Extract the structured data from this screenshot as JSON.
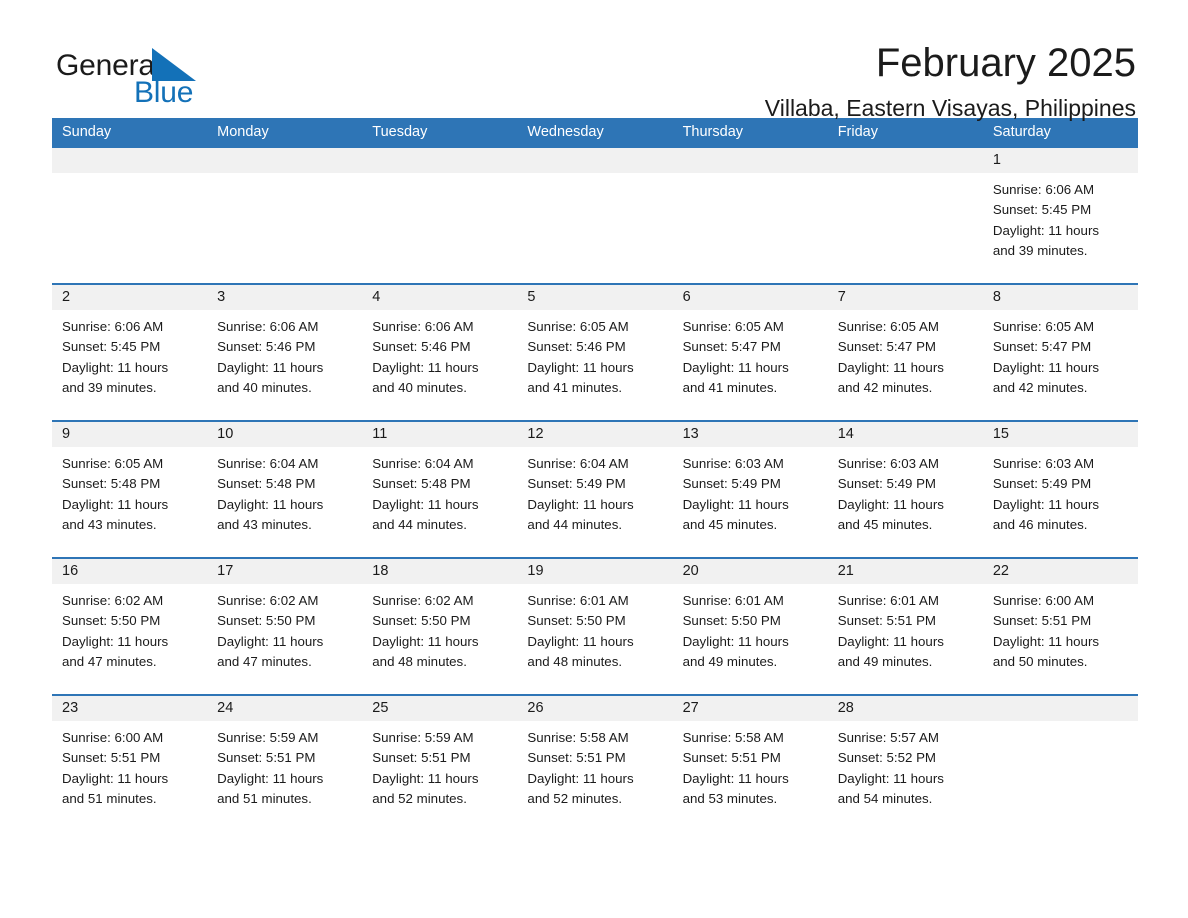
{
  "brand": {
    "name_part1": "General",
    "name_part2": "Blue",
    "flag_icon": "triangle-flag-icon",
    "accent_color": "#1371b8"
  },
  "header": {
    "month_title": "February 2025",
    "location": "Villaba, Eastern Visayas, Philippines"
  },
  "calendar": {
    "header_color": "#2e75b6",
    "daynumber_band_color": "#f1f1f1",
    "weekdays": [
      "Sunday",
      "Monday",
      "Tuesday",
      "Wednesday",
      "Thursday",
      "Friday",
      "Saturday"
    ],
    "weeks": [
      {
        "days": [
          {
            "number": "",
            "sunrise": "",
            "sunset": "",
            "daylight_line1": "",
            "daylight_line2": ""
          },
          {
            "number": "",
            "sunrise": "",
            "sunset": "",
            "daylight_line1": "",
            "daylight_line2": ""
          },
          {
            "number": "",
            "sunrise": "",
            "sunset": "",
            "daylight_line1": "",
            "daylight_line2": ""
          },
          {
            "number": "",
            "sunrise": "",
            "sunset": "",
            "daylight_line1": "",
            "daylight_line2": ""
          },
          {
            "number": "",
            "sunrise": "",
            "sunset": "",
            "daylight_line1": "",
            "daylight_line2": ""
          },
          {
            "number": "",
            "sunrise": "",
            "sunset": "",
            "daylight_line1": "",
            "daylight_line2": ""
          },
          {
            "number": "1",
            "sunrise": "Sunrise: 6:06 AM",
            "sunset": "Sunset: 5:45 PM",
            "daylight_line1": "Daylight: 11 hours",
            "daylight_line2": "and 39 minutes."
          }
        ]
      },
      {
        "days": [
          {
            "number": "2",
            "sunrise": "Sunrise: 6:06 AM",
            "sunset": "Sunset: 5:45 PM",
            "daylight_line1": "Daylight: 11 hours",
            "daylight_line2": "and 39 minutes."
          },
          {
            "number": "3",
            "sunrise": "Sunrise: 6:06 AM",
            "sunset": "Sunset: 5:46 PM",
            "daylight_line1": "Daylight: 11 hours",
            "daylight_line2": "and 40 minutes."
          },
          {
            "number": "4",
            "sunrise": "Sunrise: 6:06 AM",
            "sunset": "Sunset: 5:46 PM",
            "daylight_line1": "Daylight: 11 hours",
            "daylight_line2": "and 40 minutes."
          },
          {
            "number": "5",
            "sunrise": "Sunrise: 6:05 AM",
            "sunset": "Sunset: 5:46 PM",
            "daylight_line1": "Daylight: 11 hours",
            "daylight_line2": "and 41 minutes."
          },
          {
            "number": "6",
            "sunrise": "Sunrise: 6:05 AM",
            "sunset": "Sunset: 5:47 PM",
            "daylight_line1": "Daylight: 11 hours",
            "daylight_line2": "and 41 minutes."
          },
          {
            "number": "7",
            "sunrise": "Sunrise: 6:05 AM",
            "sunset": "Sunset: 5:47 PM",
            "daylight_line1": "Daylight: 11 hours",
            "daylight_line2": "and 42 minutes."
          },
          {
            "number": "8",
            "sunrise": "Sunrise: 6:05 AM",
            "sunset": "Sunset: 5:47 PM",
            "daylight_line1": "Daylight: 11 hours",
            "daylight_line2": "and 42 minutes."
          }
        ]
      },
      {
        "days": [
          {
            "number": "9",
            "sunrise": "Sunrise: 6:05 AM",
            "sunset": "Sunset: 5:48 PM",
            "daylight_line1": "Daylight: 11 hours",
            "daylight_line2": "and 43 minutes."
          },
          {
            "number": "10",
            "sunrise": "Sunrise: 6:04 AM",
            "sunset": "Sunset: 5:48 PM",
            "daylight_line1": "Daylight: 11 hours",
            "daylight_line2": "and 43 minutes."
          },
          {
            "number": "11",
            "sunrise": "Sunrise: 6:04 AM",
            "sunset": "Sunset: 5:48 PM",
            "daylight_line1": "Daylight: 11 hours",
            "daylight_line2": "and 44 minutes."
          },
          {
            "number": "12",
            "sunrise": "Sunrise: 6:04 AM",
            "sunset": "Sunset: 5:49 PM",
            "daylight_line1": "Daylight: 11 hours",
            "daylight_line2": "and 44 minutes."
          },
          {
            "number": "13",
            "sunrise": "Sunrise: 6:03 AM",
            "sunset": "Sunset: 5:49 PM",
            "daylight_line1": "Daylight: 11 hours",
            "daylight_line2": "and 45 minutes."
          },
          {
            "number": "14",
            "sunrise": "Sunrise: 6:03 AM",
            "sunset": "Sunset: 5:49 PM",
            "daylight_line1": "Daylight: 11 hours",
            "daylight_line2": "and 45 minutes."
          },
          {
            "number": "15",
            "sunrise": "Sunrise: 6:03 AM",
            "sunset": "Sunset: 5:49 PM",
            "daylight_line1": "Daylight: 11 hours",
            "daylight_line2": "and 46 minutes."
          }
        ]
      },
      {
        "days": [
          {
            "number": "16",
            "sunrise": "Sunrise: 6:02 AM",
            "sunset": "Sunset: 5:50 PM",
            "daylight_line1": "Daylight: 11 hours",
            "daylight_line2": "and 47 minutes."
          },
          {
            "number": "17",
            "sunrise": "Sunrise: 6:02 AM",
            "sunset": "Sunset: 5:50 PM",
            "daylight_line1": "Daylight: 11 hours",
            "daylight_line2": "and 47 minutes."
          },
          {
            "number": "18",
            "sunrise": "Sunrise: 6:02 AM",
            "sunset": "Sunset: 5:50 PM",
            "daylight_line1": "Daylight: 11 hours",
            "daylight_line2": "and 48 minutes."
          },
          {
            "number": "19",
            "sunrise": "Sunrise: 6:01 AM",
            "sunset": "Sunset: 5:50 PM",
            "daylight_line1": "Daylight: 11 hours",
            "daylight_line2": "and 48 minutes."
          },
          {
            "number": "20",
            "sunrise": "Sunrise: 6:01 AM",
            "sunset": "Sunset: 5:50 PM",
            "daylight_line1": "Daylight: 11 hours",
            "daylight_line2": "and 49 minutes."
          },
          {
            "number": "21",
            "sunrise": "Sunrise: 6:01 AM",
            "sunset": "Sunset: 5:51 PM",
            "daylight_line1": "Daylight: 11 hours",
            "daylight_line2": "and 49 minutes."
          },
          {
            "number": "22",
            "sunrise": "Sunrise: 6:00 AM",
            "sunset": "Sunset: 5:51 PM",
            "daylight_line1": "Daylight: 11 hours",
            "daylight_line2": "and 50 minutes."
          }
        ]
      },
      {
        "days": [
          {
            "number": "23",
            "sunrise": "Sunrise: 6:00 AM",
            "sunset": "Sunset: 5:51 PM",
            "daylight_line1": "Daylight: 11 hours",
            "daylight_line2": "and 51 minutes."
          },
          {
            "number": "24",
            "sunrise": "Sunrise: 5:59 AM",
            "sunset": "Sunset: 5:51 PM",
            "daylight_line1": "Daylight: 11 hours",
            "daylight_line2": "and 51 minutes."
          },
          {
            "number": "25",
            "sunrise": "Sunrise: 5:59 AM",
            "sunset": "Sunset: 5:51 PM",
            "daylight_line1": "Daylight: 11 hours",
            "daylight_line2": "and 52 minutes."
          },
          {
            "number": "26",
            "sunrise": "Sunrise: 5:58 AM",
            "sunset": "Sunset: 5:51 PM",
            "daylight_line1": "Daylight: 11 hours",
            "daylight_line2": "and 52 minutes."
          },
          {
            "number": "27",
            "sunrise": "Sunrise: 5:58 AM",
            "sunset": "Sunset: 5:51 PM",
            "daylight_line1": "Daylight: 11 hours",
            "daylight_line2": "and 53 minutes."
          },
          {
            "number": "28",
            "sunrise": "Sunrise: 5:57 AM",
            "sunset": "Sunset: 5:52 PM",
            "daylight_line1": "Daylight: 11 hours",
            "daylight_line2": "and 54 minutes."
          },
          {
            "number": "",
            "sunrise": "",
            "sunset": "",
            "daylight_line1": "",
            "daylight_line2": ""
          }
        ]
      }
    ]
  }
}
